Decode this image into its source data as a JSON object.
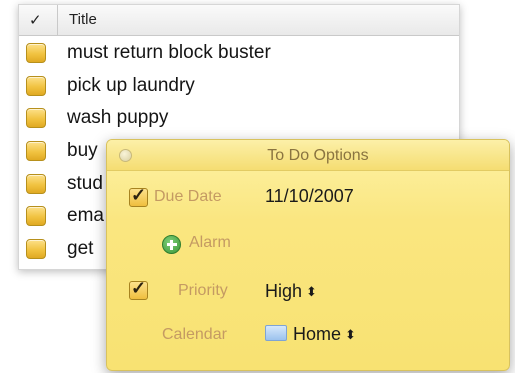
{
  "list": {
    "header": {
      "check_label": "✓",
      "title_label": "Title"
    },
    "rows": [
      {
        "title": "must return block buster"
      },
      {
        "title": "pick up laundry"
      },
      {
        "title": "wash puppy"
      },
      {
        "title": "buy"
      },
      {
        "title": "stud"
      },
      {
        "title": "ema"
      },
      {
        "title": "get"
      }
    ]
  },
  "popover": {
    "title": "To Do Options",
    "due_date": {
      "label": "Due Date",
      "value": "11/10/2007",
      "checked": true
    },
    "alarm": {
      "label": "Alarm"
    },
    "priority": {
      "label": "Priority",
      "value": "High",
      "checked": true
    },
    "calendar": {
      "label": "Calendar",
      "value": "Home",
      "swatch_color": "#a9cbf0"
    },
    "stepper_glyph": "⬍"
  },
  "colors": {
    "popover_bg": "#fae680",
    "label_text": "#c49a63",
    "checkbox_gold": "#f1c341"
  }
}
